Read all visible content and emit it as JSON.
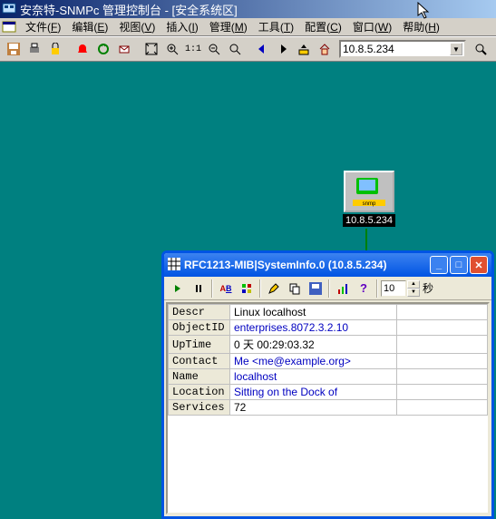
{
  "window": {
    "title": "安奈特-SNMPc 管理控制台 - [安全系统区]"
  },
  "menu": {
    "items": [
      {
        "label": "文件",
        "accel": "F"
      },
      {
        "label": "编辑",
        "accel": "E"
      },
      {
        "label": "视图",
        "accel": "V"
      },
      {
        "label": "插入",
        "accel": "I"
      },
      {
        "label": "管理",
        "accel": "M"
      },
      {
        "label": "工具",
        "accel": "T"
      },
      {
        "label": "配置",
        "accel": "C"
      },
      {
        "label": "窗口",
        "accel": "W"
      },
      {
        "label": "帮助",
        "accel": "H"
      }
    ]
  },
  "toolbar": {
    "address": "10.8.5.234"
  },
  "node": {
    "label": "10.8.5.234"
  },
  "child_window": {
    "title": "RFC1213-MIB|SystemInfo.0 (10.8.5.234)",
    "interval_value": "10",
    "interval_unit": "秒",
    "rows": [
      {
        "name": "Descr",
        "value": "Linux localhost",
        "link": false
      },
      {
        "name": "ObjectID",
        "value": "enterprises.8072.3.2.10",
        "link": true
      },
      {
        "name": "UpTime",
        "value": "0 天 00:29:03.32",
        "link": false
      },
      {
        "name": "Contact",
        "value": "Me <me@example.org>",
        "link": true
      },
      {
        "name": "Name",
        "value": "localhost",
        "link": true
      },
      {
        "name": "Location",
        "value": "Sitting on the Dock of",
        "link": true
      },
      {
        "name": "Services",
        "value": "72",
        "link": false
      }
    ]
  }
}
